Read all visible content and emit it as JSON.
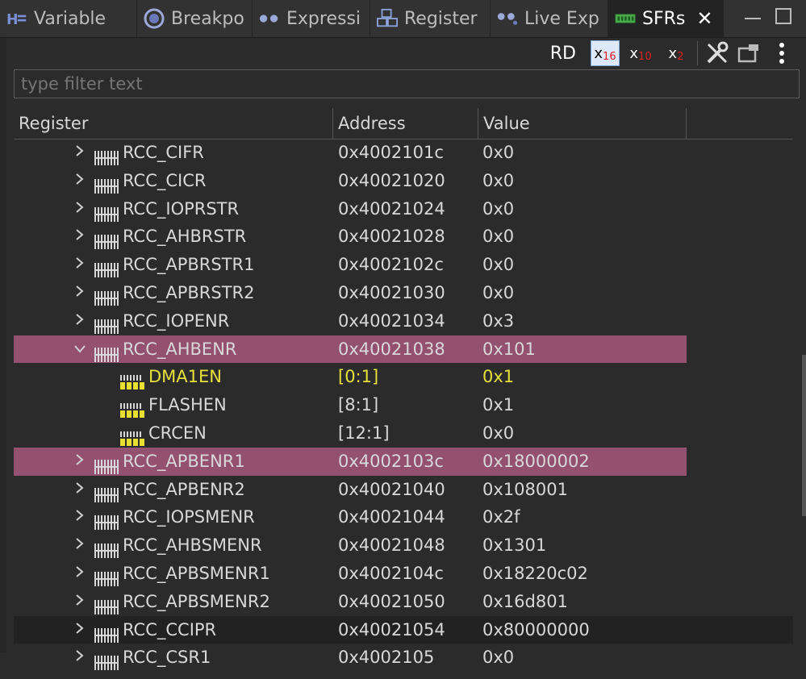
{
  "tabs": [
    {
      "label": "Variable",
      "icon": "variables-icon"
    },
    {
      "label": "Breakpo",
      "icon": "breakpoints-icon"
    },
    {
      "label": "Expressi",
      "icon": "expressions-icon"
    },
    {
      "label": "Register",
      "icon": "registers-icon"
    },
    {
      "label": "Live Exp",
      "icon": "live-expressions-icon"
    },
    {
      "label": "SFRs",
      "icon": "sfrs-icon",
      "close": "✕"
    }
  ],
  "toolbar": {
    "rd_label": "RD",
    "hex_label": "x",
    "hex_sub": "16",
    "dec_label": "x",
    "dec_sub": "10",
    "bin_label": "x",
    "bin_sub": "2"
  },
  "filter": {
    "placeholder": "type filter text"
  },
  "columns": {
    "register": "Register",
    "address": "Address",
    "value": "Value"
  },
  "rows": [
    {
      "name": "RCC_CIFR",
      "address": "0x4002101c",
      "value": "0x0"
    },
    {
      "name": "RCC_CICR",
      "address": "0x40021020",
      "value": "0x0"
    },
    {
      "name": "RCC_IOPRSTR",
      "address": "0x40021024",
      "value": "0x0"
    },
    {
      "name": "RCC_AHBRSTR",
      "address": "0x40021028",
      "value": "0x0"
    },
    {
      "name": "RCC_APBRSTR1",
      "address": "0x4002102c",
      "value": "0x0"
    },
    {
      "name": "RCC_APBRSTR2",
      "address": "0x40021030",
      "value": "0x0"
    },
    {
      "name": "RCC_IOPENR",
      "address": "0x40021034",
      "value": "0x3"
    },
    {
      "name": "RCC_AHBENR",
      "address": "0x40021038",
      "value": "0x101"
    },
    {
      "name": "DMA1EN",
      "address": "[0:1]",
      "value": "0x1"
    },
    {
      "name": "FLASHEN",
      "address": "[8:1]",
      "value": "0x1"
    },
    {
      "name": "CRCEN",
      "address": "[12:1]",
      "value": "0x0"
    },
    {
      "name": "RCC_APBENR1",
      "address": "0x4002103c",
      "value": "0x18000002"
    },
    {
      "name": "RCC_APBENR2",
      "address": "0x40021040",
      "value": "0x108001"
    },
    {
      "name": "RCC_IOPSMENR",
      "address": "0x40021044",
      "value": "0x2f"
    },
    {
      "name": "RCC_AHBSMENR",
      "address": "0x40021048",
      "value": "0x1301"
    },
    {
      "name": "RCC_APBSMENR1",
      "address": "0x4002104c",
      "value": "0x18220c02"
    },
    {
      "name": "RCC_APBSMENR2",
      "address": "0x40021050",
      "value": "0x16d801"
    },
    {
      "name": "RCC_CCIPR",
      "address": "0x40021054",
      "value": "0x80000000"
    },
    {
      "name": "RCC_CSR1",
      "address": "0x4002105",
      "value": "0x0"
    }
  ]
}
